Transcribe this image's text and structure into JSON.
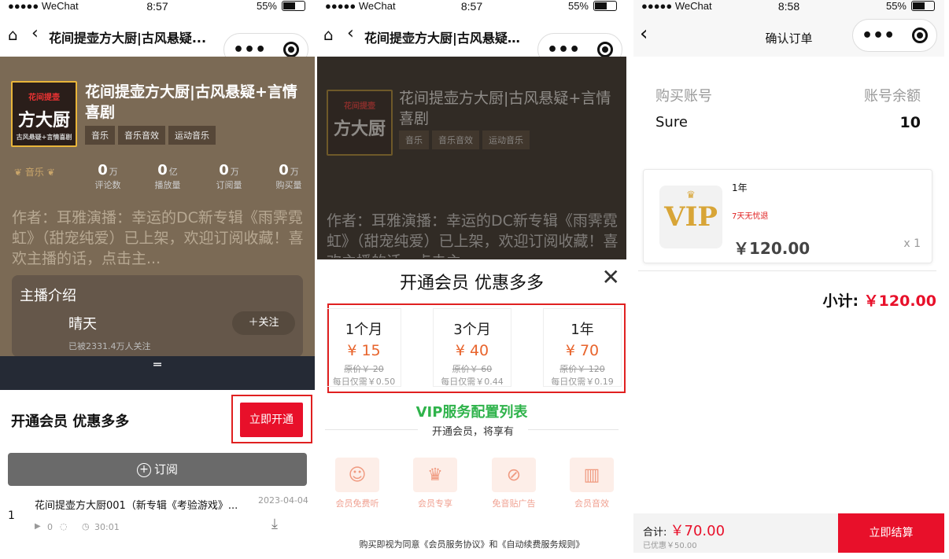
{
  "p1": {
    "status": {
      "carrier": "●●●●● WeChat",
      "time": "8:57",
      "battery": "55%"
    },
    "nav_title": "花间提壶方大厨|古风悬疑...",
    "album_title": "花间提壶方大厨|古风悬疑+言情喜剧",
    "tags": [
      "音乐",
      "音乐音效",
      "运动音乐"
    ],
    "badge": "音乐",
    "stats": [
      {
        "num": "0",
        "unit": "万",
        "label": "评论数"
      },
      {
        "num": "0",
        "unit": "亿",
        "label": "播放量"
      },
      {
        "num": "0",
        "unit": "万",
        "label": "订阅量"
      },
      {
        "num": "0",
        "unit": "万",
        "label": "购买量"
      }
    ],
    "description": "作者：耳雅演播：幸运的DC新专辑《雨霁霓虹》（甜宠纯爱）已上架，欢迎订阅收藏！喜欢主播的话，点击主...",
    "anchor_header": "主播介绍",
    "anchor_name": "晴天",
    "follow_label": "＋关注",
    "followers": "已被2331.4万人关注",
    "vip_text": "开通会员 优惠多多",
    "vip_button": "立即开通",
    "subscribe": "订阅",
    "episode": {
      "index": "1",
      "title": "花间提壶方大厨001（新专辑《考验游戏》...",
      "date": "2023-04-04",
      "plays": "0",
      "duration": "30:01"
    }
  },
  "p2": {
    "status": {
      "carrier": "●●●●● WeChat",
      "time": "8:57",
      "battery": "55%"
    },
    "sheet_title": "开通会员 优惠多多",
    "plans": [
      {
        "duration": "1个月",
        "price": "¥ 15",
        "original": "原价￥ 20",
        "daily": "每日仅需￥0.50"
      },
      {
        "duration": "3个月",
        "price": "¥ 40",
        "original": "原价￥ 60",
        "daily": "每日仅需￥0.44"
      },
      {
        "duration": "1年",
        "price": "¥ 70",
        "original": "原价￥ 120",
        "daily": "每日仅需￥0.19"
      }
    ],
    "annotation": "VIP服务配置列表",
    "benefit_caption": "开通会员，将享有",
    "features": [
      "会员免费听",
      "会员专享",
      "免音贴广告",
      "会员音效"
    ],
    "agreement": "购买即视为同意《会员服务协议》和《自动续费服务规则》"
  },
  "p3": {
    "status": {
      "carrier": "●●●●● WeChat",
      "time": "8:58",
      "battery": "55%"
    },
    "nav_title": "确认订单",
    "account_label": "购买账号",
    "balance_label": "账号余额",
    "account_value": "Sure",
    "balance_value": "10",
    "item_name": "1年",
    "item_note": "7天无忧退",
    "item_price": "￥120.00",
    "item_qty": "x 1",
    "vip_logo": "VIP",
    "subtotal_label": "小计:",
    "subtotal_value": "￥120.00",
    "total_label": "合计:",
    "total_value": "￥70.00",
    "discount": "已优惠￥50.00",
    "checkout": "立即结算"
  },
  "colors": {
    "accent": "#e8102a",
    "price": "#e8642c",
    "annotation": "#2fb34b",
    "highlight": "#e02020"
  }
}
